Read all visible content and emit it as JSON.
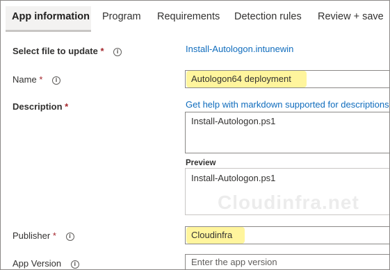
{
  "tabs": [
    {
      "label": "App information",
      "active": true
    },
    {
      "label": "Program"
    },
    {
      "label": "Requirements"
    },
    {
      "label": "Detection rules"
    },
    {
      "label": "Review + save"
    }
  ],
  "fields": {
    "select_file": {
      "label": "Select file to update",
      "required_mark": "*",
      "info": "i",
      "value": "Install-Autologon.intunewin"
    },
    "name": {
      "label": "Name",
      "required_mark": "*",
      "info": "i",
      "value": "Autologon64 deployment"
    },
    "description": {
      "label": "Description",
      "required_mark": "*",
      "help_link": "Get help with markdown supported for descriptions",
      "value": "Install-Autologon.ps1",
      "preview_label": "Preview",
      "preview_text": "Install-Autologon.ps1"
    },
    "publisher": {
      "label": "Publisher",
      "required_mark": "*",
      "info": "i",
      "value": "Cloudinfra"
    },
    "app_version": {
      "label": "App Version",
      "info": "i",
      "placeholder": "Enter the app version"
    }
  },
  "watermark": "Cloudinfra.net",
  "colors": {
    "highlight": "#fff59d",
    "link": "#0f6cbd",
    "required": "#a4262c"
  }
}
